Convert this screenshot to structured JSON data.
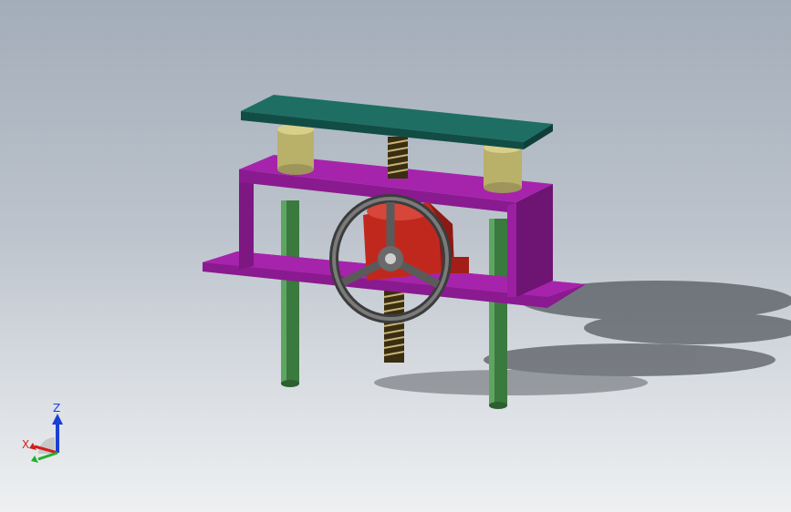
{
  "viewport": {
    "background_top": "#a3adb9",
    "background_bottom": "#eef0f2"
  },
  "model": {
    "colors": {
      "top_plate": "#1e6e63",
      "frame": "#9b1fa0",
      "posts": "#3a7a3e",
      "bushings": "#b9b06a",
      "gearbox": "#c0281e",
      "handwheel": "#5a5a5a",
      "screw": "#3a2e10"
    }
  },
  "triad": {
    "z_label": "Z",
    "x_label": "X",
    "z_color": "#1a3fd6",
    "x_color": "#d21f1f",
    "y_color": "#1fb02a"
  }
}
